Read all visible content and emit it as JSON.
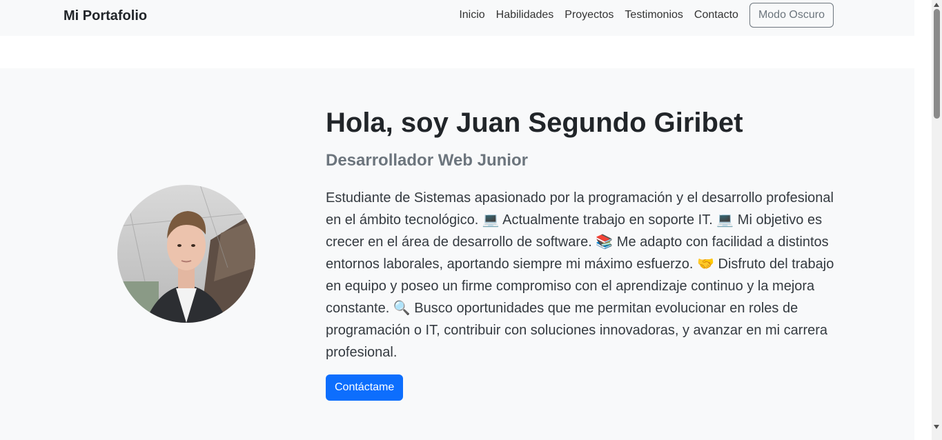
{
  "navbar": {
    "brand": "Mi Portafolio",
    "links": [
      "Inicio",
      "Habilidades",
      "Proyectos",
      "Testimonios",
      "Contacto"
    ],
    "dark_mode_label": "Modo Oscuro"
  },
  "hero": {
    "title": "Hola, soy Juan Segundo Giribet",
    "subtitle": "Desarrollador Web Junior",
    "description": "Estudiante de Sistemas apasionado por la programación y el desarrollo profesional en el ámbito tecnológico. 💻 Actualmente trabajo en soporte IT. 💻 Mi objetivo es crecer en el área de desarrollo de software. 📚 Me adapto con facilidad a distintos entornos laborales, aportando siempre mi máximo esfuerzo. 🤝 Disfruto del trabajo en equipo y poseo un firme compromiso con el aprendizaje continuo y la mejora constante. 🔍 Busco oportunidades que me permitan evolucionar en roles de programación o IT, contribuir con soluciones innovadoras, y avanzar en mi carrera profesional.",
    "contact_button": "Contáctame"
  },
  "colors": {
    "primary": "#0d6efd",
    "secondary": "#6c757d",
    "light_bg": "#f8f9fa"
  }
}
